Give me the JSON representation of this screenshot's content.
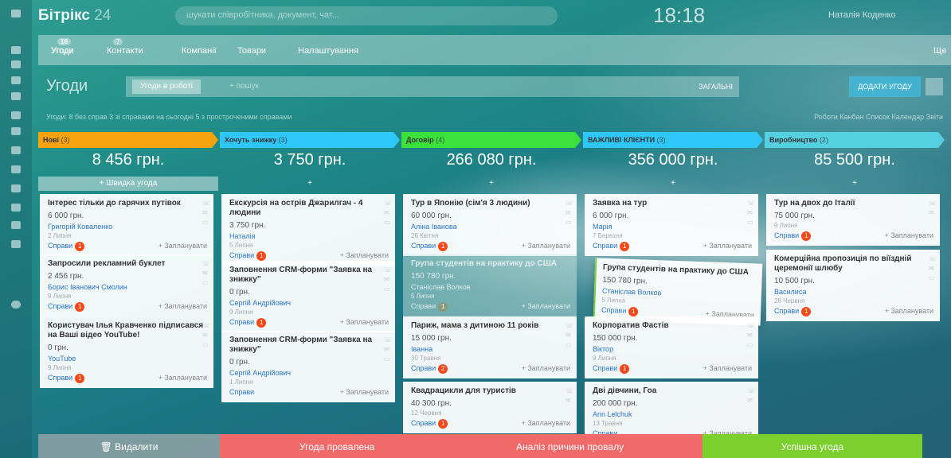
{
  "topbar": {
    "logo": "Бітрікс",
    "logo_num": "24",
    "search_placeholder": "шукати співробітника, документ, чат...",
    "clock": "18:18",
    "user": "Наталія Коденко"
  },
  "tabs": [
    {
      "label": "Угоди",
      "count": "16",
      "active": true
    },
    {
      "label": "Контакти",
      "count": "7"
    },
    {
      "label": "Компанії"
    },
    {
      "label": "Товари"
    },
    {
      "label": "Налаштування"
    }
  ],
  "tabs_more": "Ще",
  "header": {
    "title": "Угоди",
    "filter_chip": "Угоди в роботі",
    "filter_placeholder": "+ пошук",
    "total_label": "ЗАГАЛЬНІ",
    "add_button": "ДОДАТИ УГОДУ"
  },
  "infobar": {
    "text": "Угоди: 8 без справ   3 зі справами на сьогодні   5 з простроченими справами",
    "views": "Роботи   Канбан   Список   Календар   Звіти"
  },
  "columns": [
    {
      "name": "Нові",
      "count": "(3)",
      "color": "#f6a30e",
      "sum": "8 456 грн.",
      "quick": "+ Швидка угода",
      "cards": [
        {
          "title": "Інтерес тільки до гарячих путівок",
          "price": "6 000 грн.",
          "contact": "Григорій Коваленко",
          "date": "2 Липня",
          "deals": "Справи",
          "badge": "1",
          "plan": "+ Запланувати"
        },
        {
          "title": "Запросили рекламний буклет",
          "price": "2 456 грн.",
          "contact": "Борис Іванович Смолин",
          "date": "9 Липня",
          "deals": "Справи",
          "badge": "1",
          "plan": "+ Запланувати"
        },
        {
          "title": "Користувач Ілья Кравченко підписався на Ваші відео YouTube!",
          "price": "0 грн.",
          "contact": "YouTube",
          "date": "9 Липня",
          "deals": "Справи",
          "badge": "1",
          "plan": "+ Запланувати"
        }
      ]
    },
    {
      "name": "Хочуть знижку",
      "count": "(3)",
      "color": "#2fc7f7",
      "sum": "3 750 грн.",
      "quick": "+",
      "cards": [
        {
          "title": "Екскурсія на острів Джарилгач - 4 людини",
          "price": "3 750 грн.",
          "contact": "Наталія",
          "date": "5 Липня",
          "deals": "Справи",
          "badge": "1",
          "plan": "+ Запланувати"
        },
        {
          "title": "Заповнення CRM-форми \"Заявка на знижку\"",
          "price": "0 грн.",
          "contact": "Сергій Андрійович",
          "date": "9 Липня",
          "deals": "Справи",
          "badge": "1",
          "plan": "+ Запланувати"
        },
        {
          "title": "Заповнення CRM-форми \"Заявка на знижку\"",
          "price": "0 грн.",
          "contact": "Сергій Андрійович",
          "date": "1 Липня",
          "deals": "Справи",
          "badge": "",
          "plan": "+ Запланувати"
        }
      ]
    },
    {
      "name": "Договір",
      "count": "(4)",
      "color": "#3be23b",
      "sum": "266 080 грн.",
      "quick": "+",
      "cards": [
        {
          "title": "Тур в Японію (сім'я 3 людини)",
          "price": "60 000 грн.",
          "contact": "Аліна Іванова",
          "date": "26 Квітня",
          "deals": "Справи",
          "badge": "1",
          "plan": "+ Запланувати"
        },
        {
          "title": "Група студентів на практику до США",
          "price": "150 780 грн.",
          "contact": "Станіслав Волков",
          "date": "5 Липня",
          "deals": "Справи",
          "badge": "1",
          "plan": "+ Запланувати"
        },
        {
          "title": "Париж, мама з дитиною 11 років",
          "price": "15 000 грн.",
          "contact": "Іванна",
          "date": "30 Травня",
          "deals": "Справи",
          "badge": "2",
          "plan": "+ Запланувати"
        },
        {
          "title": "Квадрацикли для туристів",
          "price": "40 300 грн.",
          "contact": "",
          "date": "12 Червня",
          "deals": "Справи",
          "badge": "1",
          "plan": "+ Запланувати"
        }
      ]
    },
    {
      "name": "ВАЖЛИВІ КЛІЄНТИ",
      "count": "(3)",
      "color": "#2fc7f7",
      "sum": "356 000 грн.",
      "quick": "+",
      "cards": [
        {
          "title": "Заявка на тур",
          "price": "6 000 грн.",
          "contact": "Марія",
          "date": "7 Березня",
          "deals": "Справи",
          "badge": "1",
          "plan": "+ Запланувати"
        },
        {
          "title": "Група студентів на практику до США",
          "price": "150 780 грн.",
          "contact": "Станіслав Волков",
          "date": "5 Липня",
          "deals": "Справи",
          "badge": "1",
          "plan": "+ Запланувати"
        },
        {
          "title": "Корпоратив Фастів",
          "price": "150 000 грн.",
          "contact": "Віктор",
          "date": "9 Липня",
          "deals": "Справи",
          "badge": "1",
          "plan": "+ Запланувати"
        },
        {
          "title": "Дві дівчини, Гоа",
          "price": "200 000 грн.",
          "contact": "Ann Lelchuk",
          "date": "13 Травня",
          "deals": "Справи",
          "badge": "",
          "plan": "+ Запланувати"
        }
      ]
    },
    {
      "name": "Виробництво",
      "count": "(2)",
      "color": "#55d0e0",
      "sum": "85 500 грн.",
      "quick": "+",
      "cards": [
        {
          "title": "Тур на двох до Італії",
          "price": "75 000 грн.",
          "contact": "",
          "date": "9 Липня",
          "deals": "Справи",
          "badge": "1",
          "plan": "+ Запланувати"
        },
        {
          "title": "Комерційна пропозиція по віїздній церемонії шлюбу",
          "price": "10 500 грн.",
          "contact": "Василиса",
          "date": "28 Червня",
          "deals": "Справи",
          "badge": "1",
          "plan": "+ Запланувати"
        }
      ]
    }
  ],
  "bottom": {
    "delete": "Видалити",
    "failed": "Угода провалена",
    "analysis": "Аналіз причини провалу",
    "success": "Успішна угода"
  }
}
